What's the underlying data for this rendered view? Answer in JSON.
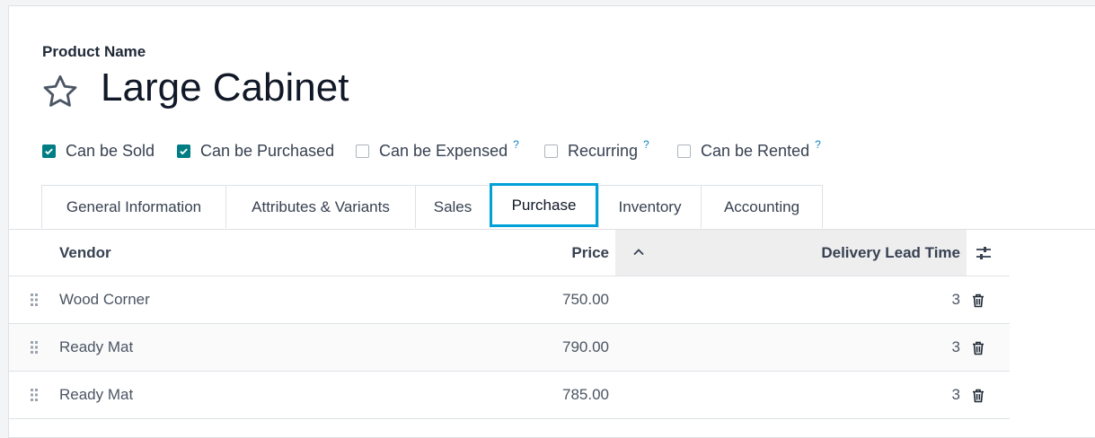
{
  "form": {
    "product_name_label": "Product Name",
    "product_name": "Large Cabinet"
  },
  "options": [
    {
      "label": "Can be Sold",
      "checked": true,
      "help": false
    },
    {
      "label": "Can be Purchased",
      "checked": true,
      "help": false
    },
    {
      "label": "Can be Expensed",
      "checked": false,
      "help": true
    },
    {
      "label": "Recurring",
      "checked": false,
      "help": true
    },
    {
      "label": "Can be Rented",
      "checked": false,
      "help": true
    }
  ],
  "help_mark": "?",
  "tabs": [
    {
      "label": "General Information"
    },
    {
      "label": "Attributes & Variants"
    },
    {
      "label": "Sales"
    },
    {
      "label": "Purchase"
    },
    {
      "label": "Inventory"
    },
    {
      "label": "Accounting"
    }
  ],
  "active_tab": "Purchase",
  "table": {
    "columns": [
      "Vendor",
      "Price",
      "Delivery Lead Time"
    ],
    "rows": [
      {
        "vendor": "Wood Corner",
        "price": "750.00",
        "lead": "3"
      },
      {
        "vendor": "Ready Mat",
        "price": "790.00",
        "lead": "3"
      },
      {
        "vendor": "Ready Mat",
        "price": "785.00",
        "lead": "3"
      }
    ]
  },
  "colors": {
    "accent": "#017e84",
    "tab_focus": "#00a0d8",
    "help": "#0b84c6"
  }
}
